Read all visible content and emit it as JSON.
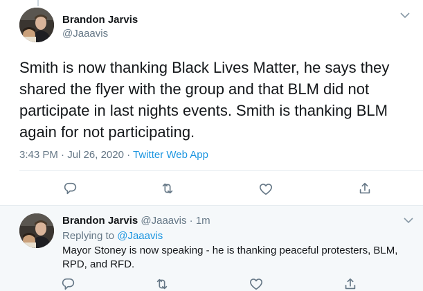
{
  "main_tweet": {
    "author_name": "Brandon Jarvis",
    "author_handle": "@Jaaavis",
    "text": "Smith is now thanking Black Lives Matter, he says they shared the flyer with the group and that BLM did not participate in last nights events. Smith is thanking BLM again for not participating.",
    "time": "3:43 PM",
    "date": "Jul 26, 2020",
    "source": "Twitter Web App",
    "actions": [
      "reply-icon",
      "retweet-icon",
      "like-icon",
      "share-icon"
    ]
  },
  "reply_tweet": {
    "author_name": "Brandon Jarvis",
    "author_handle": "@Jaaavis",
    "age": "1m",
    "replying_label": "Replying to",
    "replying_to": "@Jaaavis",
    "text": "Mayor Stoney is now speaking - he is thanking peaceful protesters, BLM, RPD, and RFD.",
    "actions": [
      "reply-icon",
      "retweet-icon",
      "like-icon",
      "share-icon"
    ]
  },
  "colors": {
    "text": "#14171a",
    "secondary": "#657786",
    "link": "#1b95e0",
    "divider": "#e6ecf0",
    "thread_bg": "#f5f8fa"
  }
}
